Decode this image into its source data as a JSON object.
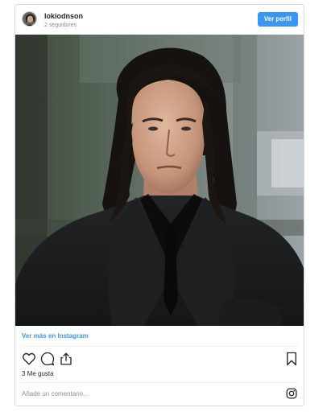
{
  "header": {
    "username": "lokiodnson",
    "followers": "2 seguidores",
    "view_profile_label": "Ver perfil"
  },
  "post": {
    "image_alt": "Long-haired man in black suit",
    "see_more_label": "Ver más en Instagram",
    "likes_label": "3 Me gusta",
    "comment_placeholder": "Añade un comentario..."
  },
  "icons": {
    "like": "heart-icon",
    "comment": "comment-icon",
    "share": "share-icon",
    "save": "bookmark-icon",
    "instagram": "instagram-icon"
  },
  "colors": {
    "accent": "#3897f0",
    "border": "#dbdbdb",
    "text": "#262626",
    "muted": "#8e8e8e"
  }
}
